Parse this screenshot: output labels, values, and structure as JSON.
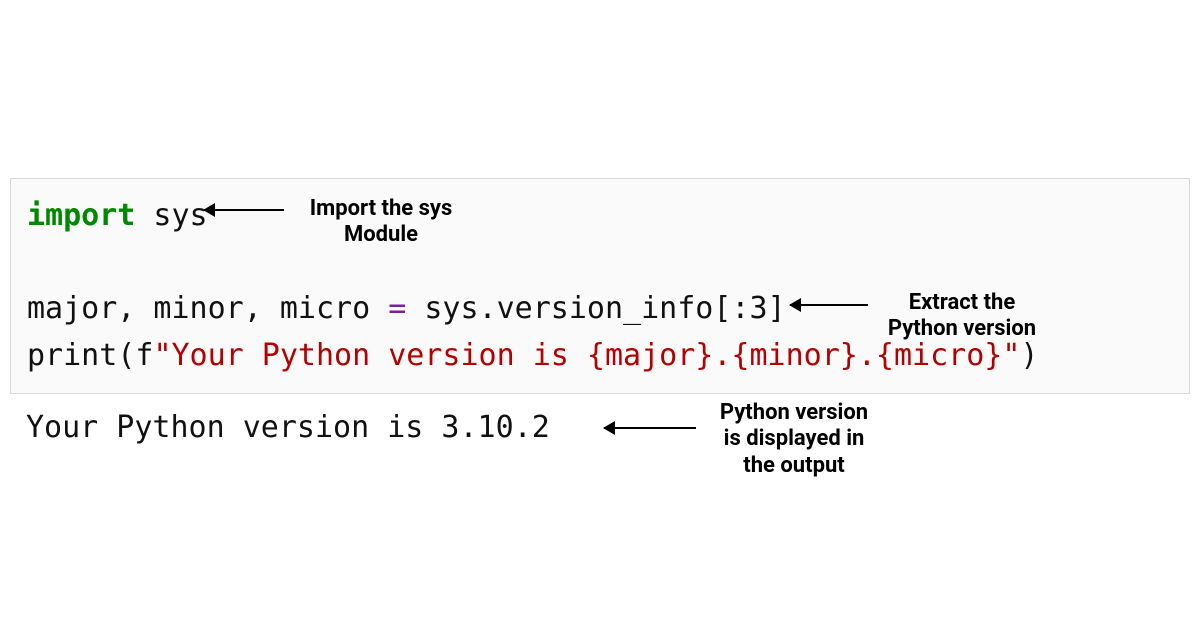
{
  "code": {
    "line1": {
      "import_kw": "import",
      "rest": " sys"
    },
    "line2_a": "major, minor, micro ",
    "line2_eq": "=",
    "line2_b": " sys.version_info[:3]",
    "line3_a": "print(f",
    "line3_str": "\"Your Python version is {major}.{minor}.{micro}\"",
    "line3_b": ")"
  },
  "output": "Your Python version is 3.10.2",
  "annotations": {
    "a1_l1": "Import the sys",
    "a1_l2": "Module",
    "a2_l1": "Extract the",
    "a2_l2": "Python version",
    "a3_l1": "Python version",
    "a3_l2": "is displayed in",
    "a3_l3": "the output"
  }
}
